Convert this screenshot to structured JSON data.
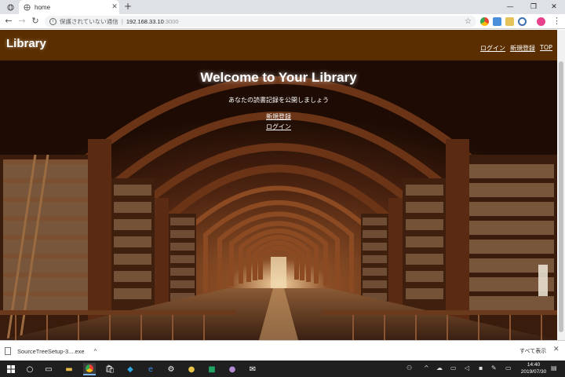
{
  "browser": {
    "tab_title": "home",
    "security_text": "保護されていない通信",
    "url_host": "192.168.33.10",
    "url_port": ":3000"
  },
  "site": {
    "brand": "Library",
    "nav": [
      "ログイン",
      "新規登録",
      "TOP"
    ],
    "hero_title": "Welcome to Your Library",
    "hero_subtitle": "あなたの読書記録を公開しましょう",
    "hero_links": [
      "新規登録",
      "ログイン"
    ]
  },
  "download_bar": {
    "file_name": "SourceTreeSetup-3....exe",
    "show_all": "すべて表示"
  },
  "taskbar": {
    "time": "14:40",
    "date": "2019/07/30"
  },
  "colors": {
    "header_bg": "#5a2e00",
    "taskbar_bg": "#1f1f1f"
  }
}
